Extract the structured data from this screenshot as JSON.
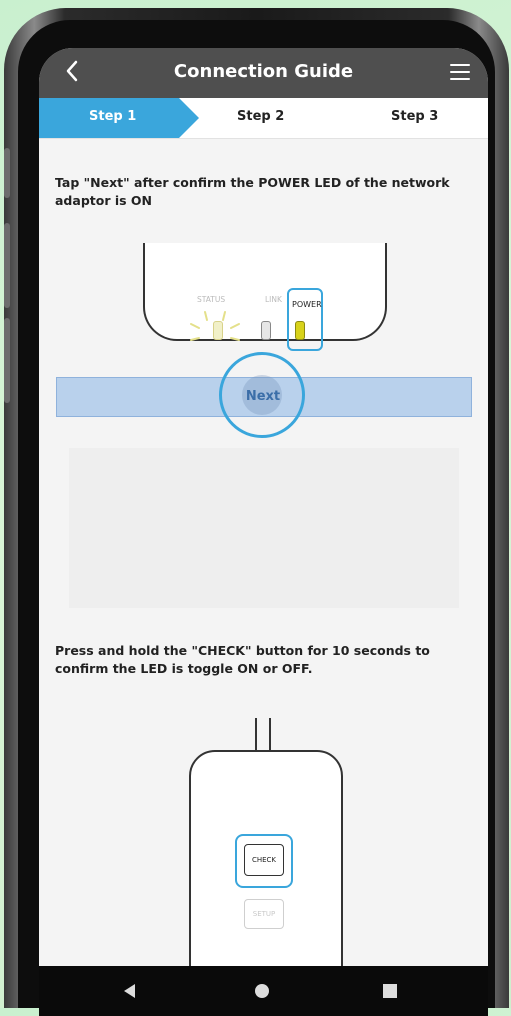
{
  "header": {
    "title": "Connection Guide"
  },
  "steps": [
    {
      "label": "Step 1",
      "active": true
    },
    {
      "label": "Step 2",
      "active": false
    },
    {
      "label": "Step 3",
      "active": false
    }
  ],
  "section1": {
    "instruction": "Tap \"Next\" after confirm the POWER LED of the network adaptor  is ON",
    "led_labels": {
      "status": "STATUS",
      "link": "LINK",
      "power": "POWER"
    },
    "next_label": "Next"
  },
  "section2": {
    "instruction": "Press and hold the \"CHECK\" button for 10 seconds to confirm the LED is toggle ON or OFF.",
    "check_label": "CHECK",
    "setup_label": "SETUP"
  },
  "icons": {
    "back": "back-arrow-icon",
    "menu": "hamburger-menu-icon",
    "nav_back": "nav-back-icon",
    "nav_home": "nav-home-icon",
    "nav_recent": "nav-recent-apps-icon"
  },
  "colors": {
    "accent": "#3aa6dc",
    "appbar": "#4f4f4f",
    "power_led": "#d8d21a"
  }
}
